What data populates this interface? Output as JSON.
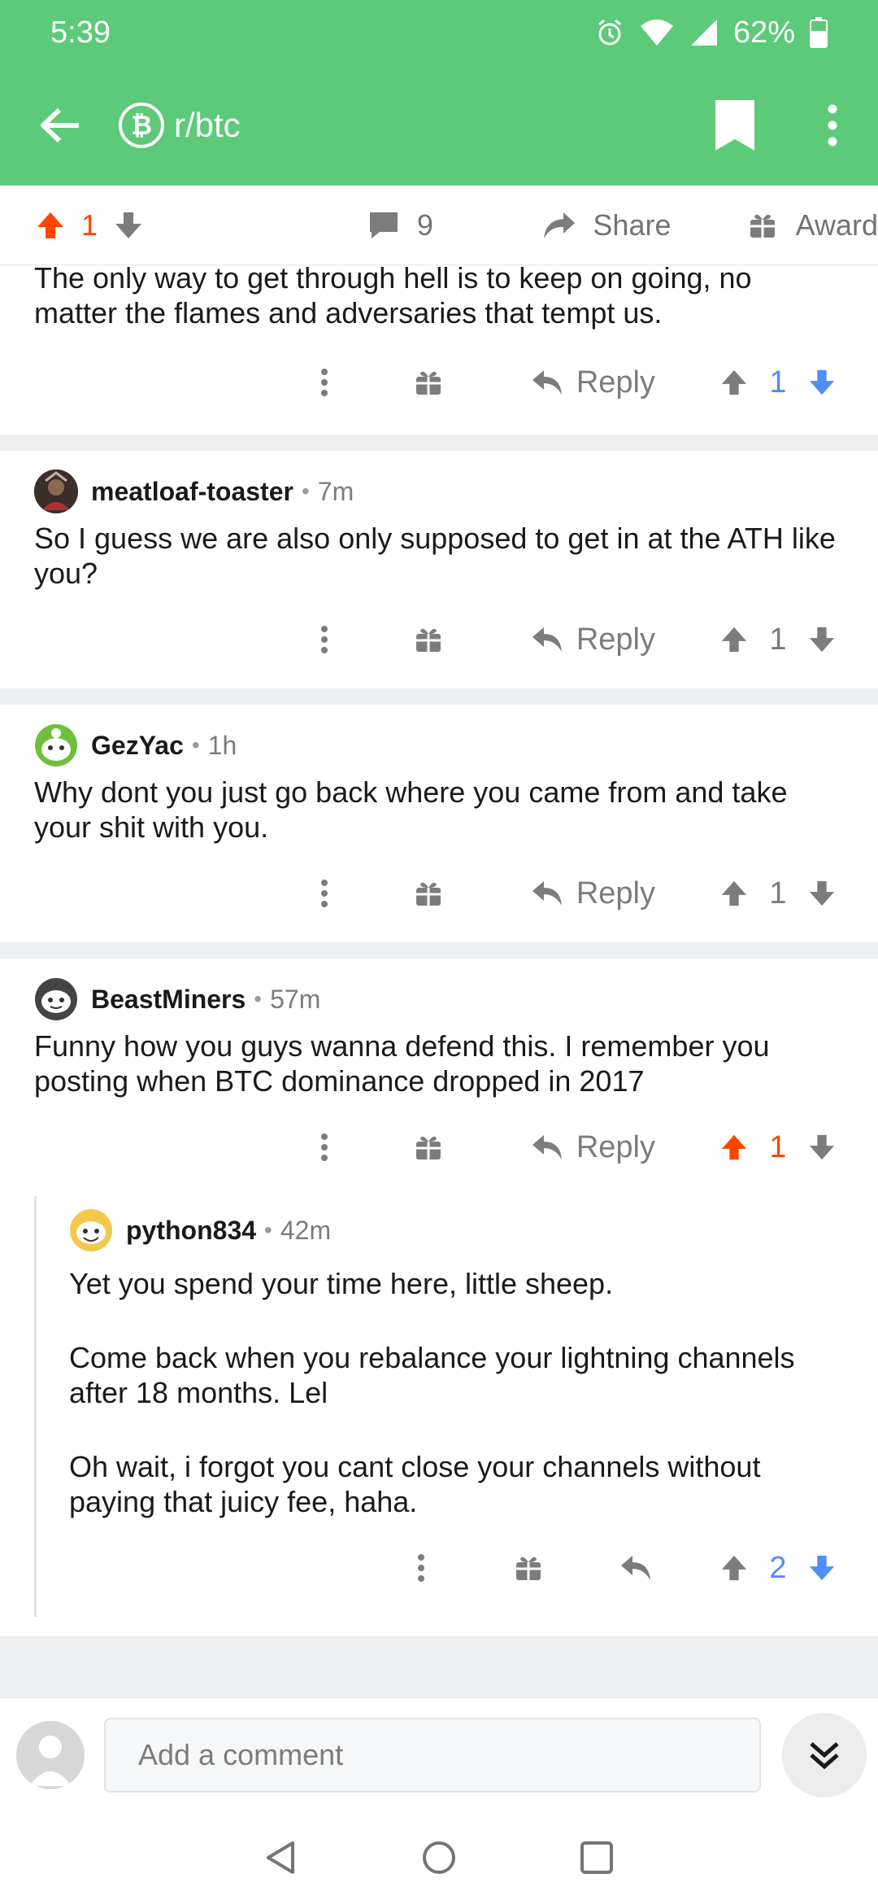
{
  "status_bar": {
    "time": "5:39",
    "battery": "62%"
  },
  "header": {
    "subreddit": "r/btc",
    "sub_icon_glyph": "₿"
  },
  "post_bar": {
    "votes": "1",
    "comments": "9",
    "share": "Share",
    "award": "Award"
  },
  "comments": [
    {
      "partial": true,
      "body": [
        "The only way to get through hell is to keep on going, no matter the flames and adversaries that tempt us."
      ],
      "reply": "Reply",
      "score": "1",
      "vote_state": "downvoted"
    },
    {
      "author": "meatloaf-toaster",
      "age": "7m",
      "body": [
        "So I guess we are also only supposed to get in at the ATH like you?"
      ],
      "reply": "Reply",
      "score": "1",
      "vote_state": "none"
    },
    {
      "author": "GezYac",
      "age": "1h",
      "body": [
        "Why dont you just go back where you came from and take your shit with you."
      ],
      "reply": "Reply",
      "score": "1",
      "vote_state": "none"
    },
    {
      "author": "BeastMiners",
      "age": "57m",
      "body": [
        "Funny how you guys wanna defend this. I remember you posting when BTC dominance dropped in 2017"
      ],
      "reply": "Reply",
      "score": "1",
      "vote_state": "upvoted"
    },
    {
      "author": "python834",
      "age": "42m",
      "nested": true,
      "body": [
        "Yet you spend your time here, little sheep.",
        "Come back when you rebalance your lightning channels after 18 months. Lel",
        "Oh wait, i forgot you cant close your channels without paying that juicy fee, haha."
      ],
      "score": "2",
      "vote_state": "downvoted"
    }
  ],
  "compose": {
    "placeholder": "Add a comment"
  },
  "colors": {
    "header": "#5cca78",
    "upvote": "#ff4500",
    "downvote": "#4f8ef7",
    "icon": "#7c7c7c"
  }
}
